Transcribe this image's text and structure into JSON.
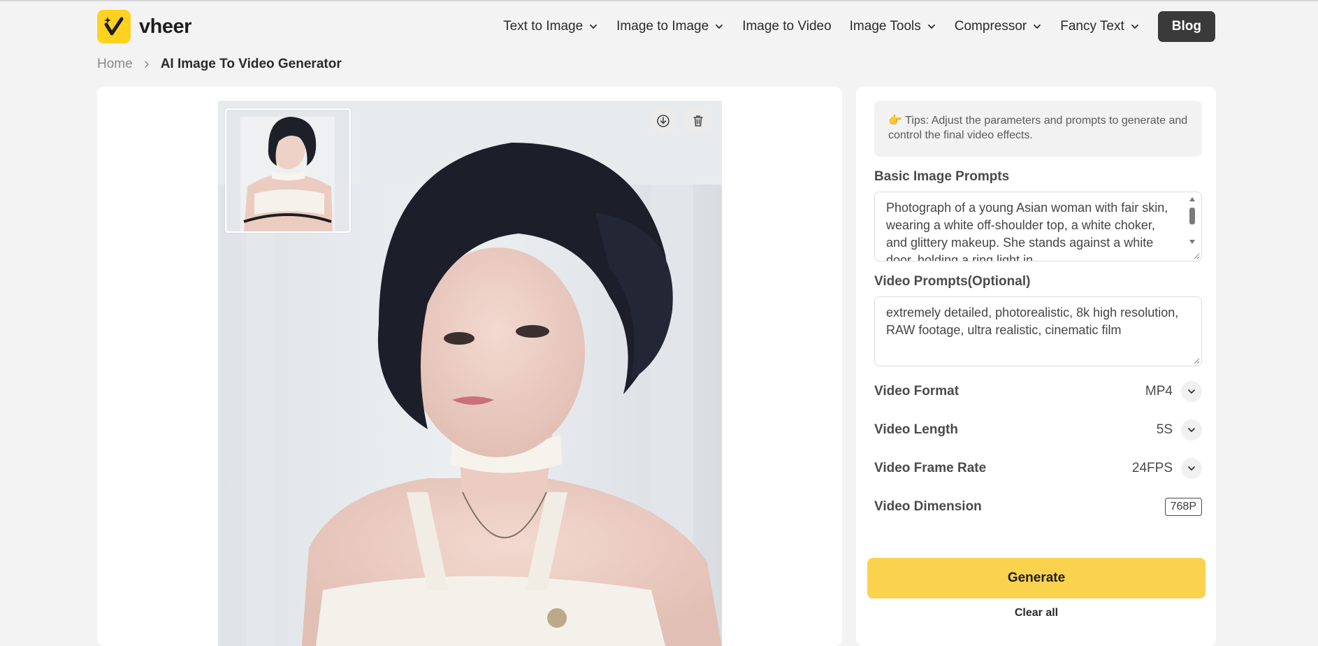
{
  "brand": {
    "name": "vheer",
    "accent": "#fcd34d",
    "logo_color": "#ffd21f"
  },
  "nav": {
    "items": [
      {
        "label": "Text to Image",
        "has_dropdown": true
      },
      {
        "label": "Image to Image",
        "has_dropdown": true
      },
      {
        "label": "Image to Video",
        "has_dropdown": false
      },
      {
        "label": "Image Tools",
        "has_dropdown": true
      },
      {
        "label": "Compressor",
        "has_dropdown": true
      },
      {
        "label": "Fancy Text",
        "has_dropdown": true
      }
    ],
    "blog_label": "Blog"
  },
  "breadcrumb": {
    "home": "Home",
    "current": "AI Image To Video Generator"
  },
  "preview": {
    "download_icon": "download-icon",
    "delete_icon": "trash-icon"
  },
  "panel": {
    "tips_emoji": "👉",
    "tips": "Tips: Adjust the parameters and prompts to generate and control the final video effects.",
    "basic_prompts_label": "Basic Image Prompts",
    "basic_prompts_value": "Photograph of a young Asian woman with fair skin, wearing a white off-shoulder top, a white choker, and glittery makeup. She stands against a white door, holding a ring light in",
    "video_prompts_label": "Video Prompts(Optional)",
    "video_prompts_value": "extremely detailed, photorealistic, 8k high resolution, RAW footage, ultra realistic, cinematic film",
    "format_label": "Video Format",
    "format_value": "MP4",
    "length_label": "Video Length",
    "length_value": "5S",
    "frame_rate_label": "Video Frame Rate",
    "frame_rate_value": "24FPS",
    "dimension_label": "Video Dimension",
    "dimension_value": "768P",
    "generate_label": "Generate",
    "clear_label": "Clear all"
  }
}
